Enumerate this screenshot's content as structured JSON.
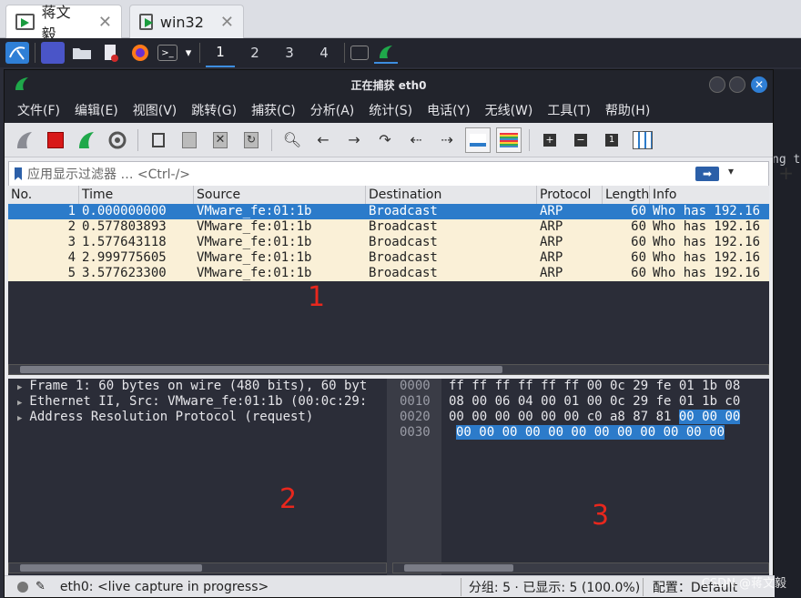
{
  "tabs": [
    {
      "label": "蒋文毅"
    },
    {
      "label": "win32"
    }
  ],
  "tab_close_glyph": "✕",
  "workspaces": [
    "1",
    "2",
    "3",
    "4"
  ],
  "window": {
    "title": "正在捕获 eth0"
  },
  "menu": [
    "文件(F)",
    "编辑(E)",
    "视图(V)",
    "跳转(G)",
    "捕获(C)",
    "分析(A)",
    "统计(S)",
    "电话(Y)",
    "无线(W)",
    "工具(T)",
    "帮助(H)"
  ],
  "filter": {
    "placeholder": "应用显示过滤器 … <Ctrl-/>"
  },
  "columns": {
    "no": "No.",
    "time": "Time",
    "source": "Source",
    "destination": "Destination",
    "protocol": "Protocol",
    "length": "Length",
    "info": "Info"
  },
  "packets": [
    {
      "no": "1",
      "time": "0.000000000",
      "source": "VMware_fe:01:1b",
      "destination": "Broadcast",
      "protocol": "ARP",
      "length": "60",
      "info": "Who has 192.16"
    },
    {
      "no": "2",
      "time": "0.577803893",
      "source": "VMware_fe:01:1b",
      "destination": "Broadcast",
      "protocol": "ARP",
      "length": "60",
      "info": "Who has 192.16"
    },
    {
      "no": "3",
      "time": "1.577643118",
      "source": "VMware_fe:01:1b",
      "destination": "Broadcast",
      "protocol": "ARP",
      "length": "60",
      "info": "Who has 192.16"
    },
    {
      "no": "4",
      "time": "2.999775605",
      "source": "VMware_fe:01:1b",
      "destination": "Broadcast",
      "protocol": "ARP",
      "length": "60",
      "info": "Who has 192.16"
    },
    {
      "no": "5",
      "time": "3.577623300",
      "source": "VMware_fe:01:1b",
      "destination": "Broadcast",
      "protocol": "ARP",
      "length": "60",
      "info": "Who has 192.16"
    }
  ],
  "details": [
    "Frame 1: 60 bytes on wire (480 bits), 60 byt",
    "Ethernet II, Src: VMware_fe:01:1b (00:0c:29:",
    "Address Resolution Protocol (request)"
  ],
  "bytes": [
    {
      "off": "0000",
      "hex": "ff ff ff ff ff ff 00 0c  29 fe 01 1b 08",
      "hl": ""
    },
    {
      "off": "0010",
      "hex": "08 00 06 04 00 01 00 0c  29 fe 01 1b c0",
      "hl": ""
    },
    {
      "off": "0020",
      "hex": "00 00 00 00 00 00 c0 a8  87 81 ",
      "hl": "00 00 00"
    },
    {
      "off": "0030",
      "hex": "",
      "hl": "00 00 00 00 00 00 00 00  00 00 00 00"
    }
  ],
  "annotations": [
    "1",
    "2",
    "3"
  ],
  "status": {
    "iface": "eth0: <live capture in progress>",
    "packets": "分组: 5 · 已显示: 5 (100.0%)",
    "profile": "配置：Default"
  },
  "bg_fragment": "ng to",
  "watermark": "CSDN @蒋文毅",
  "colors": {
    "selected_row": "#2c7bca",
    "packet_row": "#faf0d7",
    "annotation": "#e8271d"
  }
}
